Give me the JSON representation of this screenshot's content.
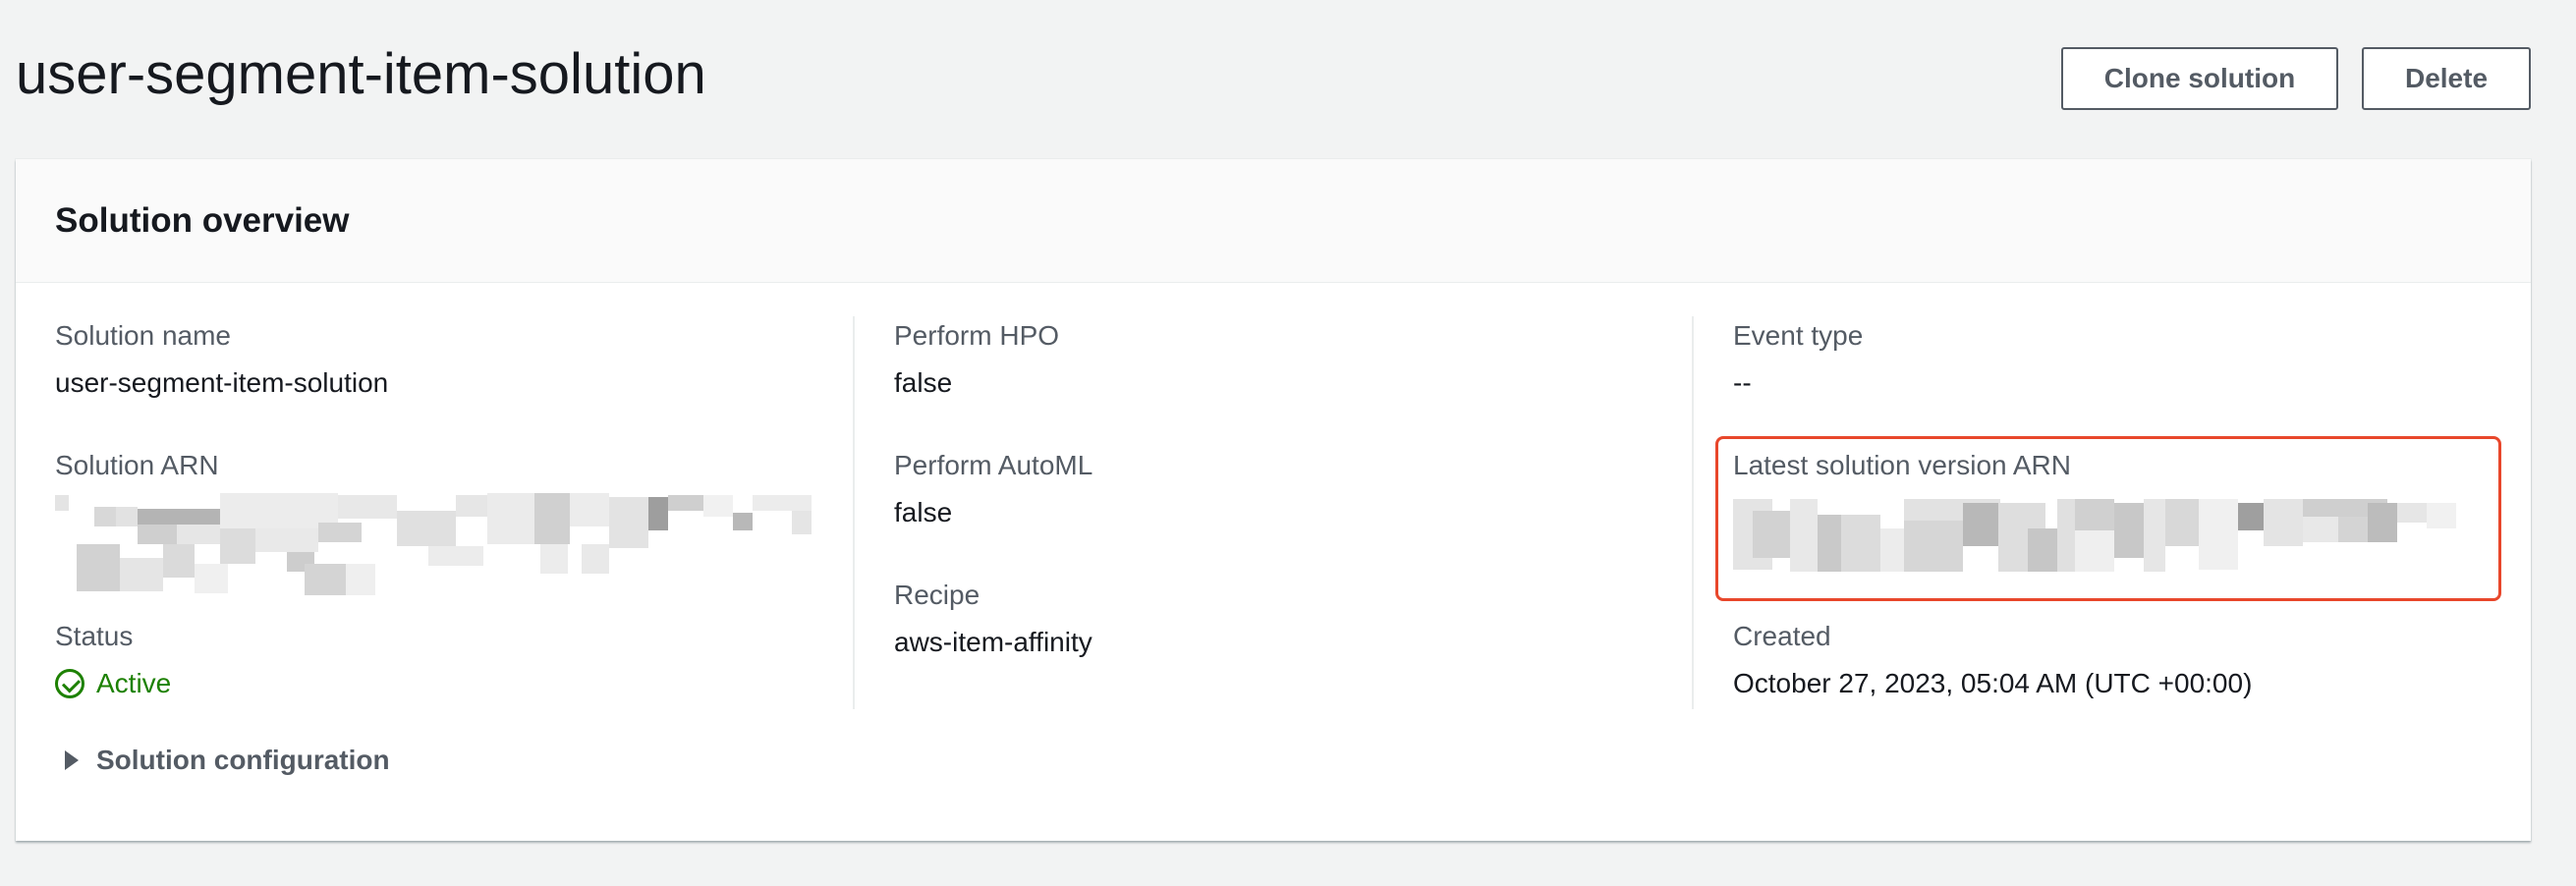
{
  "page": {
    "title": "user-segment-item-solution",
    "actions": {
      "clone_label": "Clone solution",
      "delete_label": "Delete"
    }
  },
  "overview": {
    "title": "Solution overview",
    "columns": [
      {
        "fields": [
          {
            "label": "Solution name",
            "value": "user-segment-item-solution"
          },
          {
            "label": "Solution ARN",
            "value": ""
          },
          {
            "label": "Status",
            "value": "Active",
            "icon": "check-circle-icon",
            "color": "#1d8102"
          }
        ]
      },
      {
        "fields": [
          {
            "label": "Perform HPO",
            "value": "false"
          },
          {
            "label": "Perform AutoML",
            "value": "false"
          },
          {
            "label": "Recipe",
            "value": "aws-item-affinity"
          }
        ]
      },
      {
        "fields": [
          {
            "label": "Event type",
            "value": "--"
          },
          {
            "label": "Latest solution version ARN",
            "value": ""
          },
          {
            "label": "Created",
            "value": "October 27, 2023, 05:04 AM (UTC +00:00)"
          }
        ]
      }
    ],
    "expander": {
      "label": "Solution configuration",
      "icon": "caret-right-icon"
    }
  },
  "colors": {
    "background": "#f2f3f3",
    "highlight": "#e8472b",
    "status_active": "#1d8102"
  }
}
